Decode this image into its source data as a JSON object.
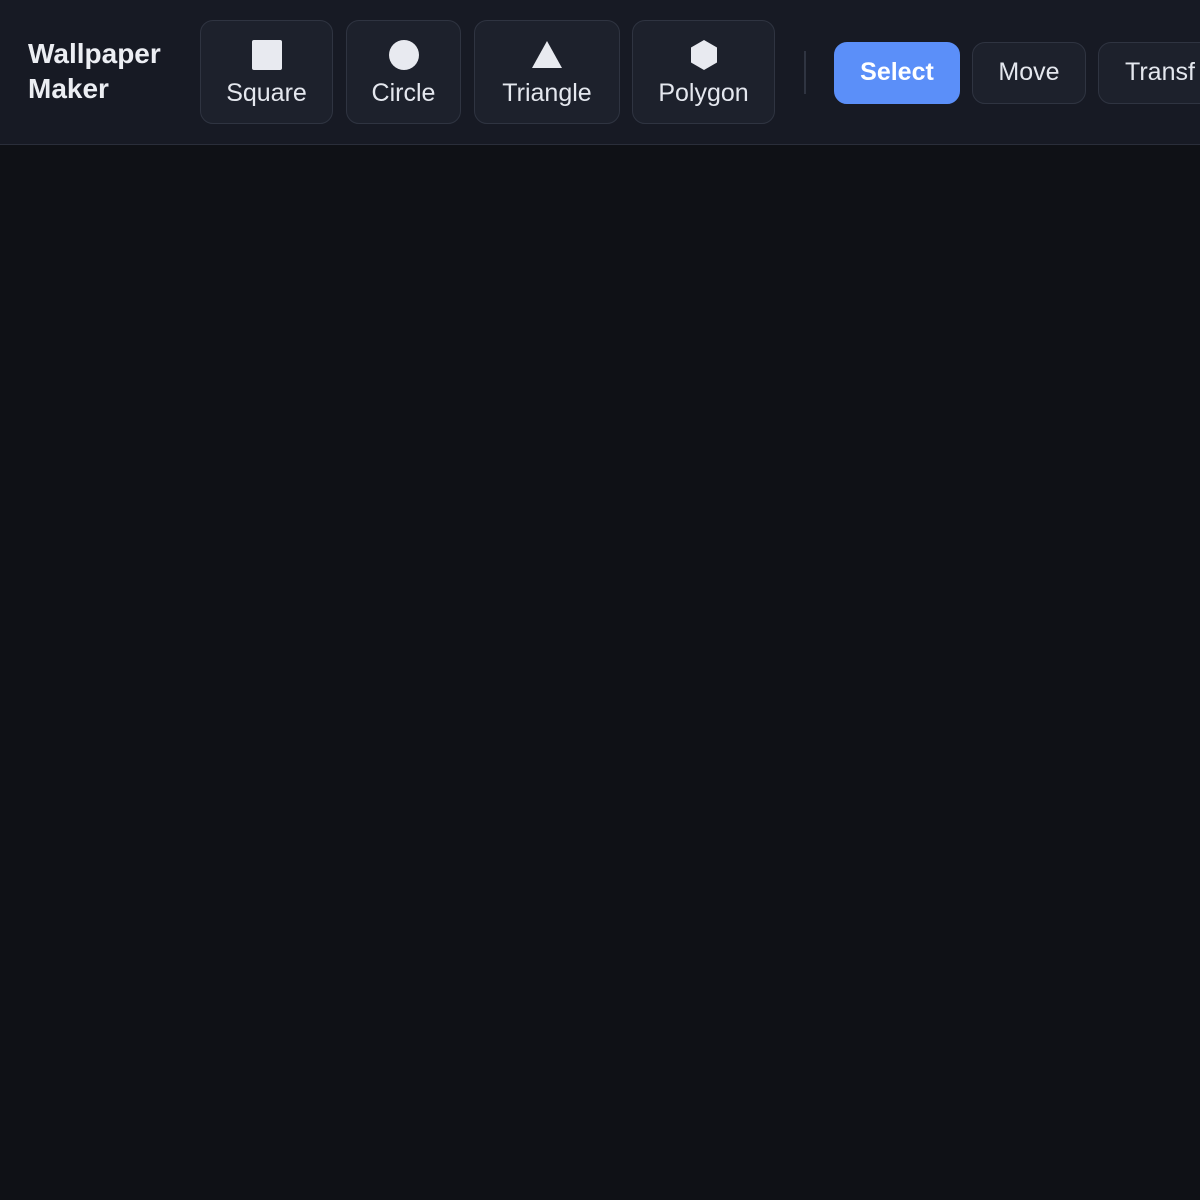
{
  "app": {
    "title": "Wallpaper\nMaker"
  },
  "shapes": [
    {
      "label": "Square",
      "icon": "square-icon"
    },
    {
      "label": "Circle",
      "icon": "circle-icon"
    },
    {
      "label": "Triangle",
      "icon": "triangle-icon"
    },
    {
      "label": "Polygon",
      "icon": "hexagon-icon"
    }
  ],
  "modes": [
    {
      "label": "Select",
      "active": true
    },
    {
      "label": "Move",
      "active": false
    },
    {
      "label": "Transf",
      "active": false
    }
  ],
  "colors": {
    "accent": "#5b8ff9",
    "toolbar_bg": "#171a24",
    "canvas_bg": "#0f1116",
    "button_bg": "#1d212c",
    "icon": "#e8eaf0"
  }
}
